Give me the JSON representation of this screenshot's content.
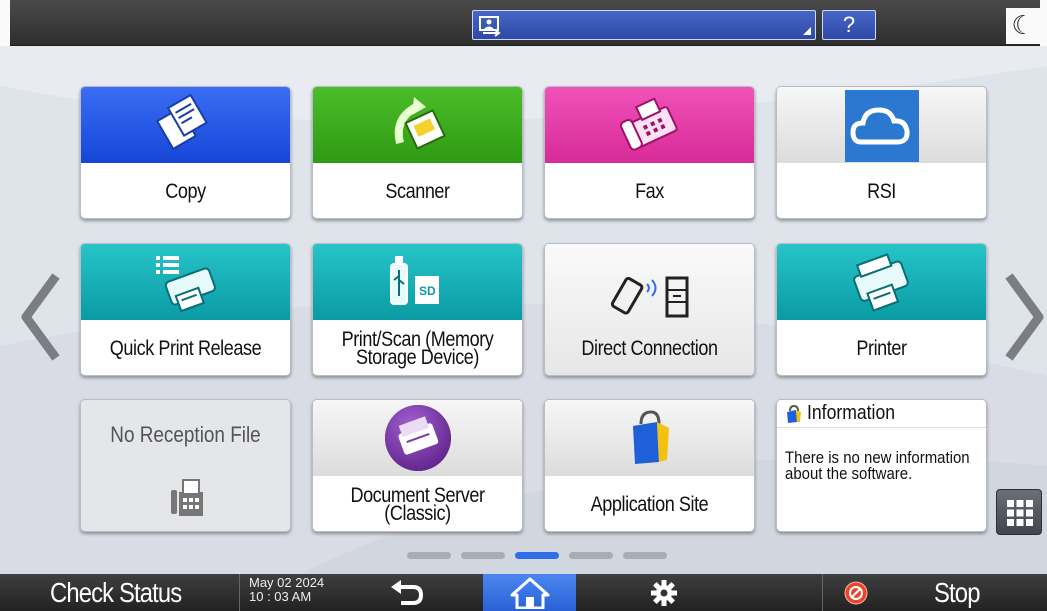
{
  "topbar": {
    "user_icon": "login-user-icon",
    "help_label": "?",
    "energy_icon": "moon-icon"
  },
  "tiles": [
    {
      "label": "Copy",
      "icon": "copy-icon"
    },
    {
      "label": "Scanner",
      "icon": "scanner-icon"
    },
    {
      "label": "Fax",
      "icon": "fax-icon"
    },
    {
      "label": "RSI",
      "icon": "cloud-icon"
    },
    {
      "label": "Quick Print Release",
      "icon": "quick-print-icon"
    },
    {
      "label": "Print/Scan (Memory Storage Device)",
      "icon": "usb-sd-icon"
    },
    {
      "label": "Direct Connection",
      "icon": "phone-printer-icon"
    },
    {
      "label": "Printer",
      "icon": "printer-icon"
    },
    {
      "label": "No Reception File",
      "icon": "fax-file-icon"
    },
    {
      "label": "Document Server (Classic)",
      "icon": "document-server-icon"
    },
    {
      "label": "Application Site",
      "icon": "shopping-bag-icon"
    }
  ],
  "info_widget": {
    "title": "Information",
    "message": "There is no new information about the software."
  },
  "pager": {
    "pages": 5,
    "active": 3
  },
  "bottombar": {
    "check_status": "Check Status",
    "date": "May 02 2024",
    "time": "10 : 03 AM",
    "stop": "Stop"
  },
  "colors": {
    "accent_blue": "#2f6ee6",
    "copy": "#1746d6",
    "scanner": "#2f9a14",
    "fax": "#d82a98",
    "teal": "#0a9ba4"
  }
}
